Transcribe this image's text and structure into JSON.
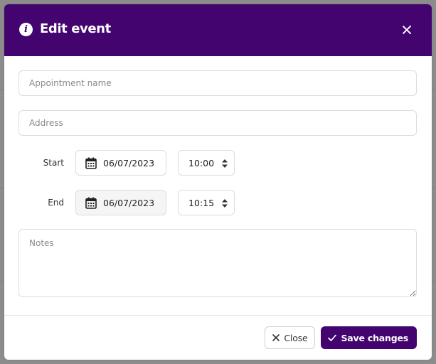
{
  "modal": {
    "title": "Edit event",
    "header_bg": "#440470"
  },
  "form": {
    "appointment_name": {
      "placeholder": "Appointment name",
      "value": ""
    },
    "address": {
      "placeholder": "Address",
      "value": ""
    },
    "start": {
      "label": "Start",
      "date": "06/07/2023",
      "time": "10:00"
    },
    "end": {
      "label": "End",
      "date": "06/07/2023",
      "time": "10:15"
    },
    "notes": {
      "placeholder": "Notes",
      "value": ""
    }
  },
  "footer": {
    "close_label": "Close",
    "save_label": "Save changes"
  },
  "icons": {
    "header": "info-icon",
    "close": "close-icon",
    "date": "calendar-icon",
    "time": "spinner-icon",
    "close_button": "x-icon",
    "save_button": "check-icon"
  }
}
